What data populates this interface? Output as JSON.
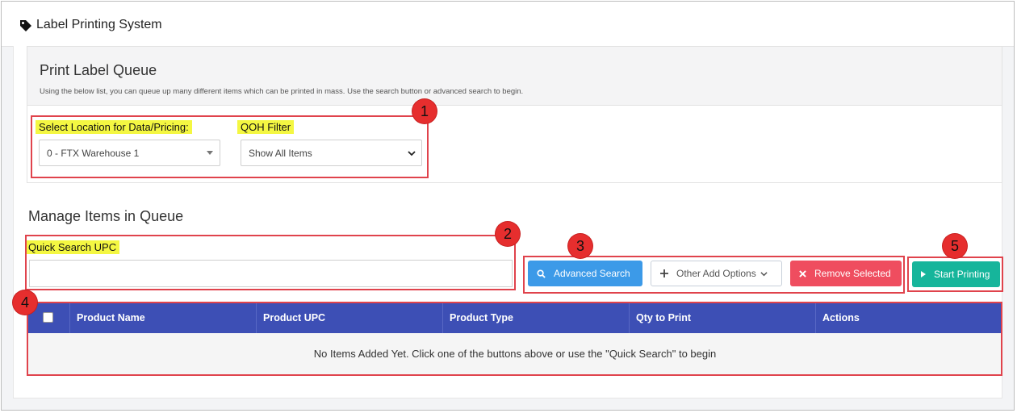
{
  "header": {
    "title": "Label Printing System",
    "icon": "tag-icon"
  },
  "queue": {
    "title": "Print Label Queue",
    "description": "Using the below list, you can queue up many different items which can be printed in mass. Use the search button or advanced search to begin.",
    "location_label": "Select Location for Data/Pricing:",
    "location_value": "0 - FTX Warehouse 1",
    "qoh_label": "QOH Filter",
    "qoh_value": "Show All Items"
  },
  "manage": {
    "title": "Manage Items in Queue",
    "quick_search_label": "Quick Search UPC",
    "quick_search_value": "",
    "buttons": {
      "advanced_search": "Advanced Search",
      "other_add_options": "Other Add Options",
      "remove_selected": "Remove Selected",
      "start_printing": "Start Printing"
    }
  },
  "table": {
    "columns": [
      "Product Name",
      "Product UPC",
      "Product Type",
      "Qty to Print",
      "Actions"
    ],
    "empty_message": "No Items Added Yet. Click one of the buttons above or use the \"Quick Search\" to begin"
  },
  "callouts": [
    "1",
    "2",
    "3",
    "4",
    "5"
  ],
  "colors": {
    "primary_blue": "#3c9ae8",
    "table_header": "#3d4fb5",
    "danger": "#ef4d5f",
    "success": "#16b59b",
    "highlight": "#f4f742",
    "callout_red": "#e62e2e"
  }
}
